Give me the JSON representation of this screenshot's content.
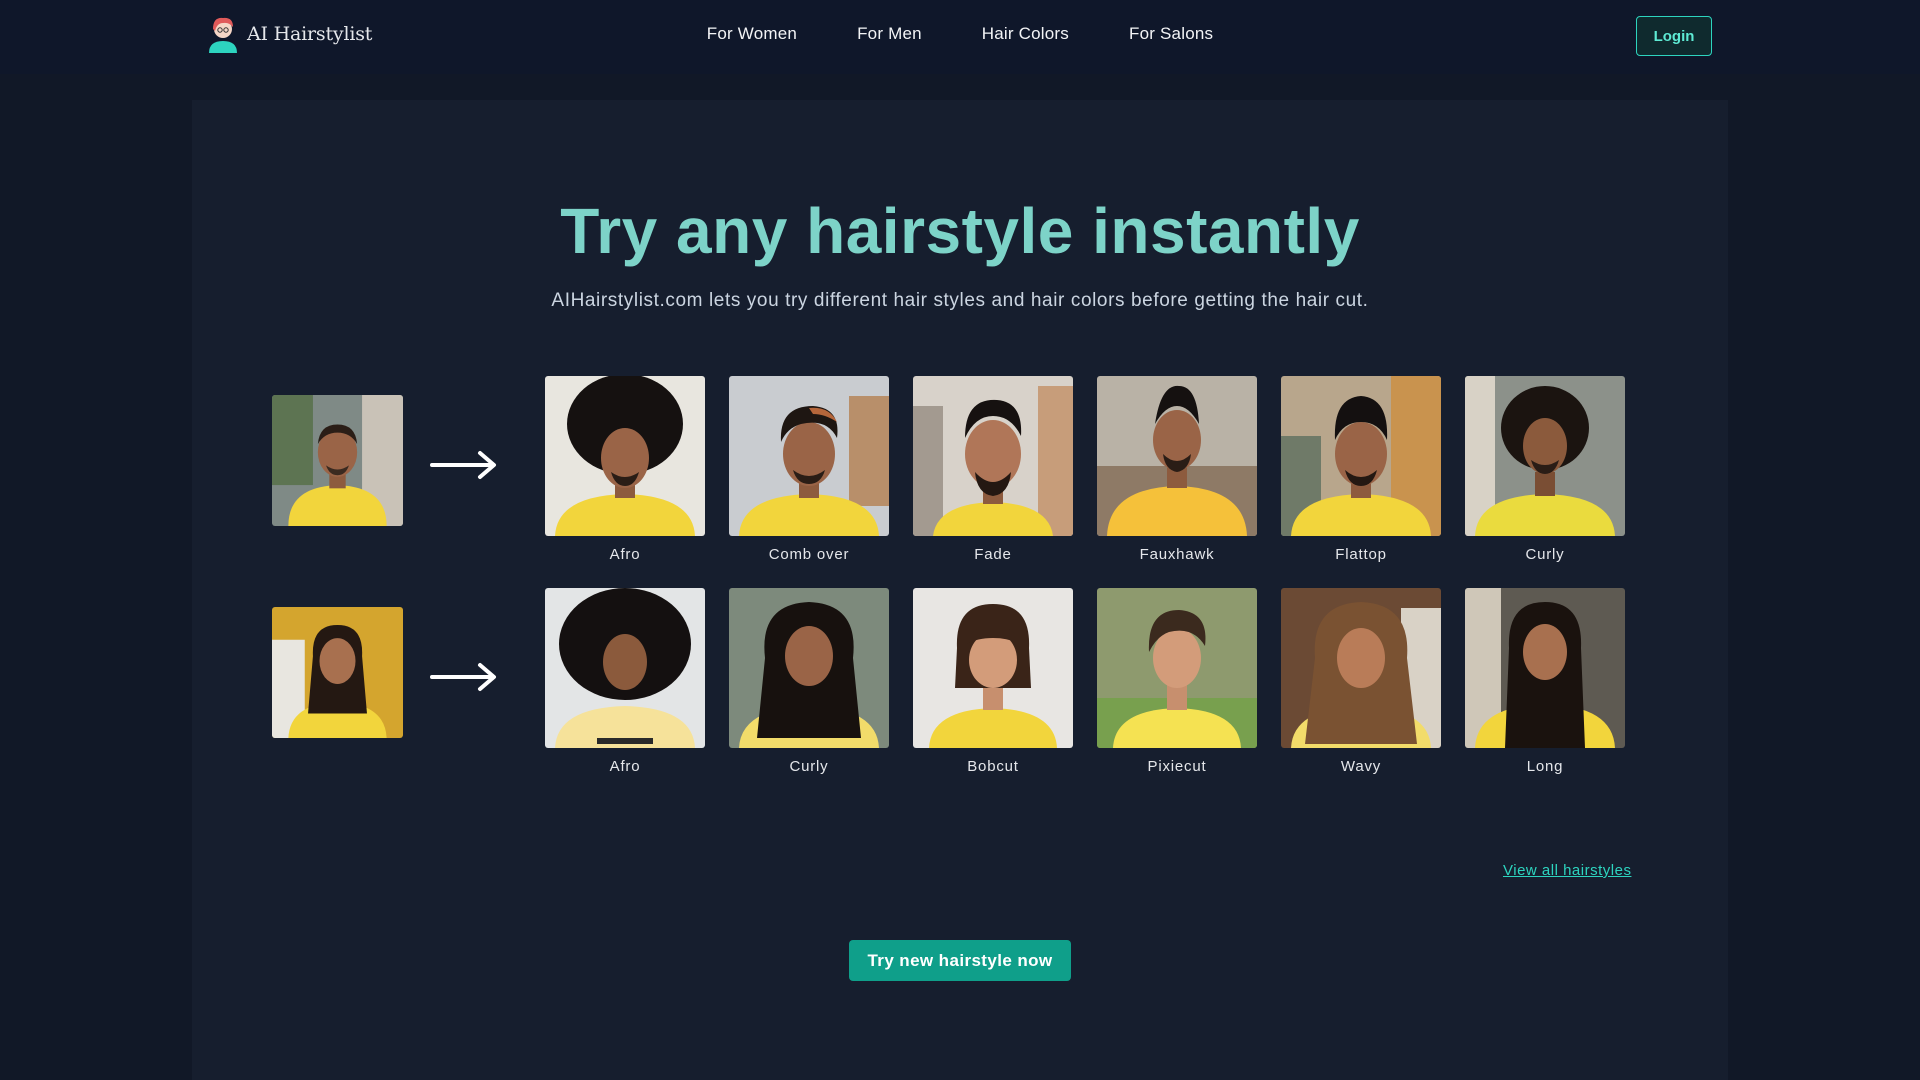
{
  "brand": {
    "name": "AI Hairstylist"
  },
  "nav": {
    "items": [
      {
        "label": "For Women"
      },
      {
        "label": "For Men"
      },
      {
        "label": "Hair Colors"
      },
      {
        "label": "For Salons"
      }
    ],
    "login_label": "Login"
  },
  "hero": {
    "headline": "Try any hairstyle instantly",
    "subtitle": "AIHairstylist.com lets you try different hair styles and hair colors before getting the hair cut."
  },
  "examples": {
    "men": {
      "source_alt": "original-man-photo",
      "styles": [
        {
          "label": "Afro",
          "hair": "afro"
        },
        {
          "label": "Comb over",
          "hair": "combover"
        },
        {
          "label": "Fade",
          "hair": "fade"
        },
        {
          "label": "Fauxhawk",
          "hair": "fauxhawk"
        },
        {
          "label": "Flattop",
          "hair": "flattop"
        },
        {
          "label": "Curly",
          "hair": "curly"
        }
      ]
    },
    "women": {
      "source_alt": "original-woman-photo",
      "styles": [
        {
          "label": "Afro",
          "hair": "afro"
        },
        {
          "label": "Curly",
          "hair": "curly-long"
        },
        {
          "label": "Bobcut",
          "hair": "bob"
        },
        {
          "label": "Pixiecut",
          "hair": "pixie"
        },
        {
          "label": "Wavy",
          "hair": "wavy"
        },
        {
          "label": "Long",
          "hair": "long"
        }
      ]
    }
  },
  "links": {
    "view_all": "View all hairstyles"
  },
  "cta": {
    "label": "Try new hairstyle now"
  },
  "colors": {
    "accent": "#2dd4bf",
    "headline": "#7dd3c8",
    "cta_bg": "#0f9f8a",
    "shirt_yellow": "#f2d53c",
    "background": "#111827"
  },
  "icons": {
    "arrow": "right-arrow-icon",
    "logo": "stylist-avatar-icon"
  }
}
